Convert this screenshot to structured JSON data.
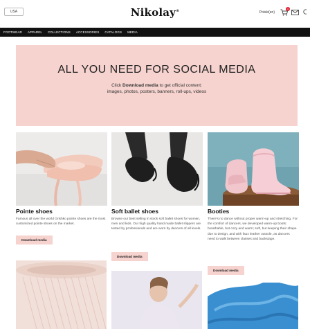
{
  "header": {
    "region": "USA",
    "logo": "Nikolay",
    "logo_mark": "®",
    "lang": "Polski(en)",
    "cart_count": "1"
  },
  "nav": [
    "FOOTWEAR",
    "APPAREL",
    "COLLECTIONS",
    "ACCESSORIES",
    "CATALOGS",
    "MEDIA"
  ],
  "hero": {
    "title": "ALL YOU NEED FOR SOCIAL MEDIA",
    "line1_prefix": "Click ",
    "line1_bold": "Download media",
    "line1_suffix": " to get official content:",
    "line2": "images, photos, posters, banners, roll-ups, videos"
  },
  "cards": [
    {
      "title": "Pointe shoes",
      "desc": "Famous all over the world Grishko pointe shoes are the most customized pointe shoes on the market.",
      "button": "Download media"
    },
    {
      "title": "Soft ballet shoes",
      "desc": "Browse our best selling in stock soft ballet shoes for women, men and kids. Our high quality hand made ballet slippers are tested by professionals and are worn by dancers of all levels.",
      "button": "Download media"
    },
    {
      "title": "Booties",
      "desc": "There's no dance without proper warm-up and stretching. For the comfort of dancers, we developed warm-up boots: breathable, but cozy and warm; soft, but keeping their shape due to design, and with faux leather outsole, as dancers need to walk between classes and backstage.",
      "button": "Download media"
    }
  ],
  "colors": {
    "accent_pink": "#f6d3cf",
    "nav_bg": "#111111"
  }
}
